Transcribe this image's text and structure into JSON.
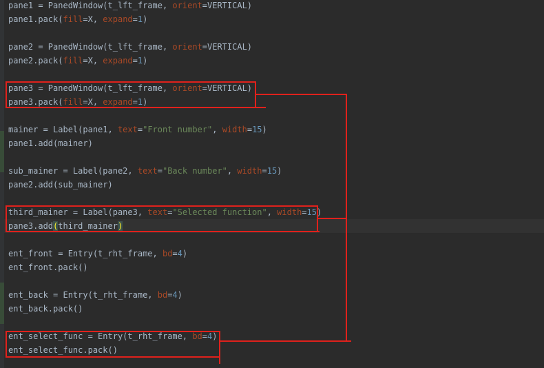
{
  "code_lines": [
    {
      "tokens": [
        {
          "t": "pane1 = PanedWindow(t_lft_frame, "
        },
        {
          "t": "orient",
          "k": "kw"
        },
        {
          "t": "=VERTICAL)"
        }
      ]
    },
    {
      "tokens": [
        {
          "t": "pane1.pack("
        },
        {
          "t": "fill",
          "k": "kw"
        },
        {
          "t": "=X, "
        },
        {
          "t": "expand",
          "k": "kw"
        },
        {
          "t": "="
        },
        {
          "t": "1",
          "k": "num"
        },
        {
          "t": ")"
        }
      ]
    },
    {
      "tokens": []
    },
    {
      "tokens": [
        {
          "t": "pane2 = PanedWindow(t_lft_frame, "
        },
        {
          "t": "orient",
          "k": "kw"
        },
        {
          "t": "=VERTICAL)"
        }
      ]
    },
    {
      "tokens": [
        {
          "t": "pane2.pack("
        },
        {
          "t": "fill",
          "k": "kw"
        },
        {
          "t": "=X, "
        },
        {
          "t": "expand",
          "k": "kw"
        },
        {
          "t": "="
        },
        {
          "t": "1",
          "k": "num"
        },
        {
          "t": ")"
        }
      ]
    },
    {
      "tokens": []
    },
    {
      "tokens": [
        {
          "t": "pane3 = PanedWindow(t_lft_frame, "
        },
        {
          "t": "orient",
          "k": "kw"
        },
        {
          "t": "=VERTICAL)"
        }
      ]
    },
    {
      "tokens": [
        {
          "t": "pane3.pack("
        },
        {
          "t": "fill",
          "k": "kw"
        },
        {
          "t": "=X, "
        },
        {
          "t": "expand",
          "k": "kw"
        },
        {
          "t": "="
        },
        {
          "t": "1",
          "k": "num"
        },
        {
          "t": ")"
        }
      ]
    },
    {
      "tokens": []
    },
    {
      "tokens": [
        {
          "t": "mainer = Label(pane1, "
        },
        {
          "t": "text",
          "k": "kw"
        },
        {
          "t": "="
        },
        {
          "t": "\"Front number\"",
          "k": "str"
        },
        {
          "t": ", "
        },
        {
          "t": "width",
          "k": "kw"
        },
        {
          "t": "="
        },
        {
          "t": "15",
          "k": "num"
        },
        {
          "t": ")"
        }
      ]
    },
    {
      "tokens": [
        {
          "t": "pane1.add(mainer)"
        }
      ]
    },
    {
      "tokens": []
    },
    {
      "tokens": [
        {
          "t": "sub_mainer = Label(pane2, "
        },
        {
          "t": "text",
          "k": "kw"
        },
        {
          "t": "="
        },
        {
          "t": "\"Back number\"",
          "k": "str"
        },
        {
          "t": ", "
        },
        {
          "t": "width",
          "k": "kw"
        },
        {
          "t": "="
        },
        {
          "t": "15",
          "k": "num"
        },
        {
          "t": ")"
        }
      ]
    },
    {
      "tokens": [
        {
          "t": "pane2.add(sub_mainer)"
        }
      ]
    },
    {
      "tokens": []
    },
    {
      "tokens": [
        {
          "t": "third_mainer = Label(pane3, "
        },
        {
          "t": "text",
          "k": "kw"
        },
        {
          "t": "="
        },
        {
          "t": "\"Selected function\"",
          "k": "str"
        },
        {
          "t": ", "
        },
        {
          "t": "width",
          "k": "kw"
        },
        {
          "t": "="
        },
        {
          "t": "15",
          "k": "num"
        },
        {
          "t": ")"
        }
      ]
    },
    {
      "current": true,
      "tokens": [
        {
          "t": "pane3.add"
        },
        {
          "t": "(",
          "k": "paren"
        },
        {
          "t": "third_mainer"
        },
        {
          "t": ")",
          "k": "paren"
        }
      ]
    },
    {
      "tokens": []
    },
    {
      "tokens": [
        {
          "t": "ent_front = Entry(t_rht_frame, "
        },
        {
          "t": "bd",
          "k": "kw"
        },
        {
          "t": "="
        },
        {
          "t": "4",
          "k": "num"
        },
        {
          "t": ")"
        }
      ]
    },
    {
      "tokens": [
        {
          "t": "ent_front.pack()"
        }
      ]
    },
    {
      "tokens": []
    },
    {
      "tokens": [
        {
          "t": "ent_back = Entry(t_rht_frame, "
        },
        {
          "t": "bd",
          "k": "kw"
        },
        {
          "t": "="
        },
        {
          "t": "4",
          "k": "num"
        },
        {
          "t": ")"
        }
      ]
    },
    {
      "tokens": [
        {
          "t": "ent_back.pack()"
        }
      ]
    },
    {
      "tokens": []
    },
    {
      "tokens": [
        {
          "t": "ent_select_func = Entry(t_rht_frame, "
        },
        {
          "t": "bd",
          "k": "kw"
        },
        {
          "t": "="
        },
        {
          "t": "4",
          "k": "num"
        },
        {
          "t": ")"
        }
      ]
    },
    {
      "tokens": [
        {
          "t": "ent_select_func.pack()"
        }
      ]
    }
  ],
  "colors": {
    "background": "#2b2b2b",
    "default_text": "#a9b7c6",
    "keyword_arg": "#aa4926",
    "string": "#6a8759",
    "number": "#6897bb",
    "annotation": "#e0211c"
  }
}
